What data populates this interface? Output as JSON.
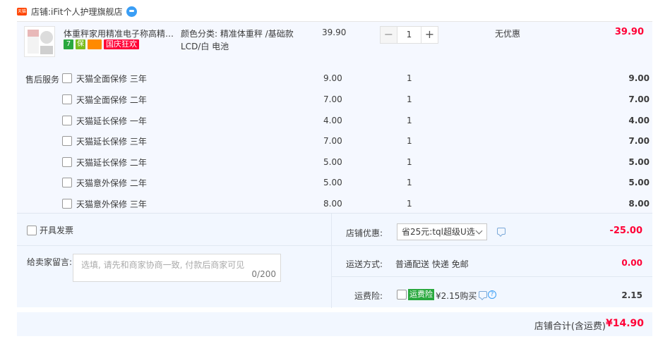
{
  "shop": {
    "logo_text": "天猫",
    "label": "店铺:",
    "name": "iFit个人护理旗舰店"
  },
  "item": {
    "title": "体重秤家用精准电子称高精度可…",
    "badges": [
      "7",
      "保",
      "",
      "国庆狂欢"
    ],
    "sku": "颜色分类: 精准体重秤 /基础款LCD/白 电池",
    "unit_price": "39.90",
    "quantity": "1",
    "minus": "−",
    "plus": "+",
    "discount": "无优惠",
    "line_total": "39.90"
  },
  "services": {
    "title": "售后服务",
    "rows": [
      {
        "name": "天猫全面保修 三年",
        "price": "9.00",
        "qty": "1",
        "total": "9.00"
      },
      {
        "name": "天猫全面保修 二年",
        "price": "7.00",
        "qty": "1",
        "total": "7.00"
      },
      {
        "name": "天猫延长保修 一年",
        "price": "4.00",
        "qty": "1",
        "total": "4.00"
      },
      {
        "name": "天猫延长保修 三年",
        "price": "7.00",
        "qty": "1",
        "total": "7.00"
      },
      {
        "name": "天猫延长保修 二年",
        "price": "5.00",
        "qty": "1",
        "total": "5.00"
      },
      {
        "name": "天猫意外保修 二年",
        "price": "5.00",
        "qty": "1",
        "total": "5.00"
      },
      {
        "name": "天猫意外保修 三年",
        "price": "8.00",
        "qty": "1",
        "total": "8.00"
      }
    ]
  },
  "invoice": {
    "label": "开具发票"
  },
  "message": {
    "label": "给卖家留言:",
    "placeholder": "选填, 请先和商家协商一致, 付款后商家可见",
    "count": "0/200"
  },
  "coupon": {
    "label": "店铺优惠:",
    "selected": "省25元:tql超级U选",
    "amount": "-25.00"
  },
  "shipping": {
    "label": "运送方式:",
    "value": "普通配送 快递 免邮",
    "amount": "0.00"
  },
  "insurance": {
    "label": "运费险:",
    "badge": "运费险",
    "text": "¥2.15购买",
    "help": "?",
    "amount": "2.15"
  },
  "total": {
    "label": "店铺合计(含运费)",
    "value": "¥14.90"
  },
  "colors": {
    "accent_red": "#ff0036",
    "badge_green": "#29a83e",
    "panel_bg": "#f2f7ff"
  }
}
